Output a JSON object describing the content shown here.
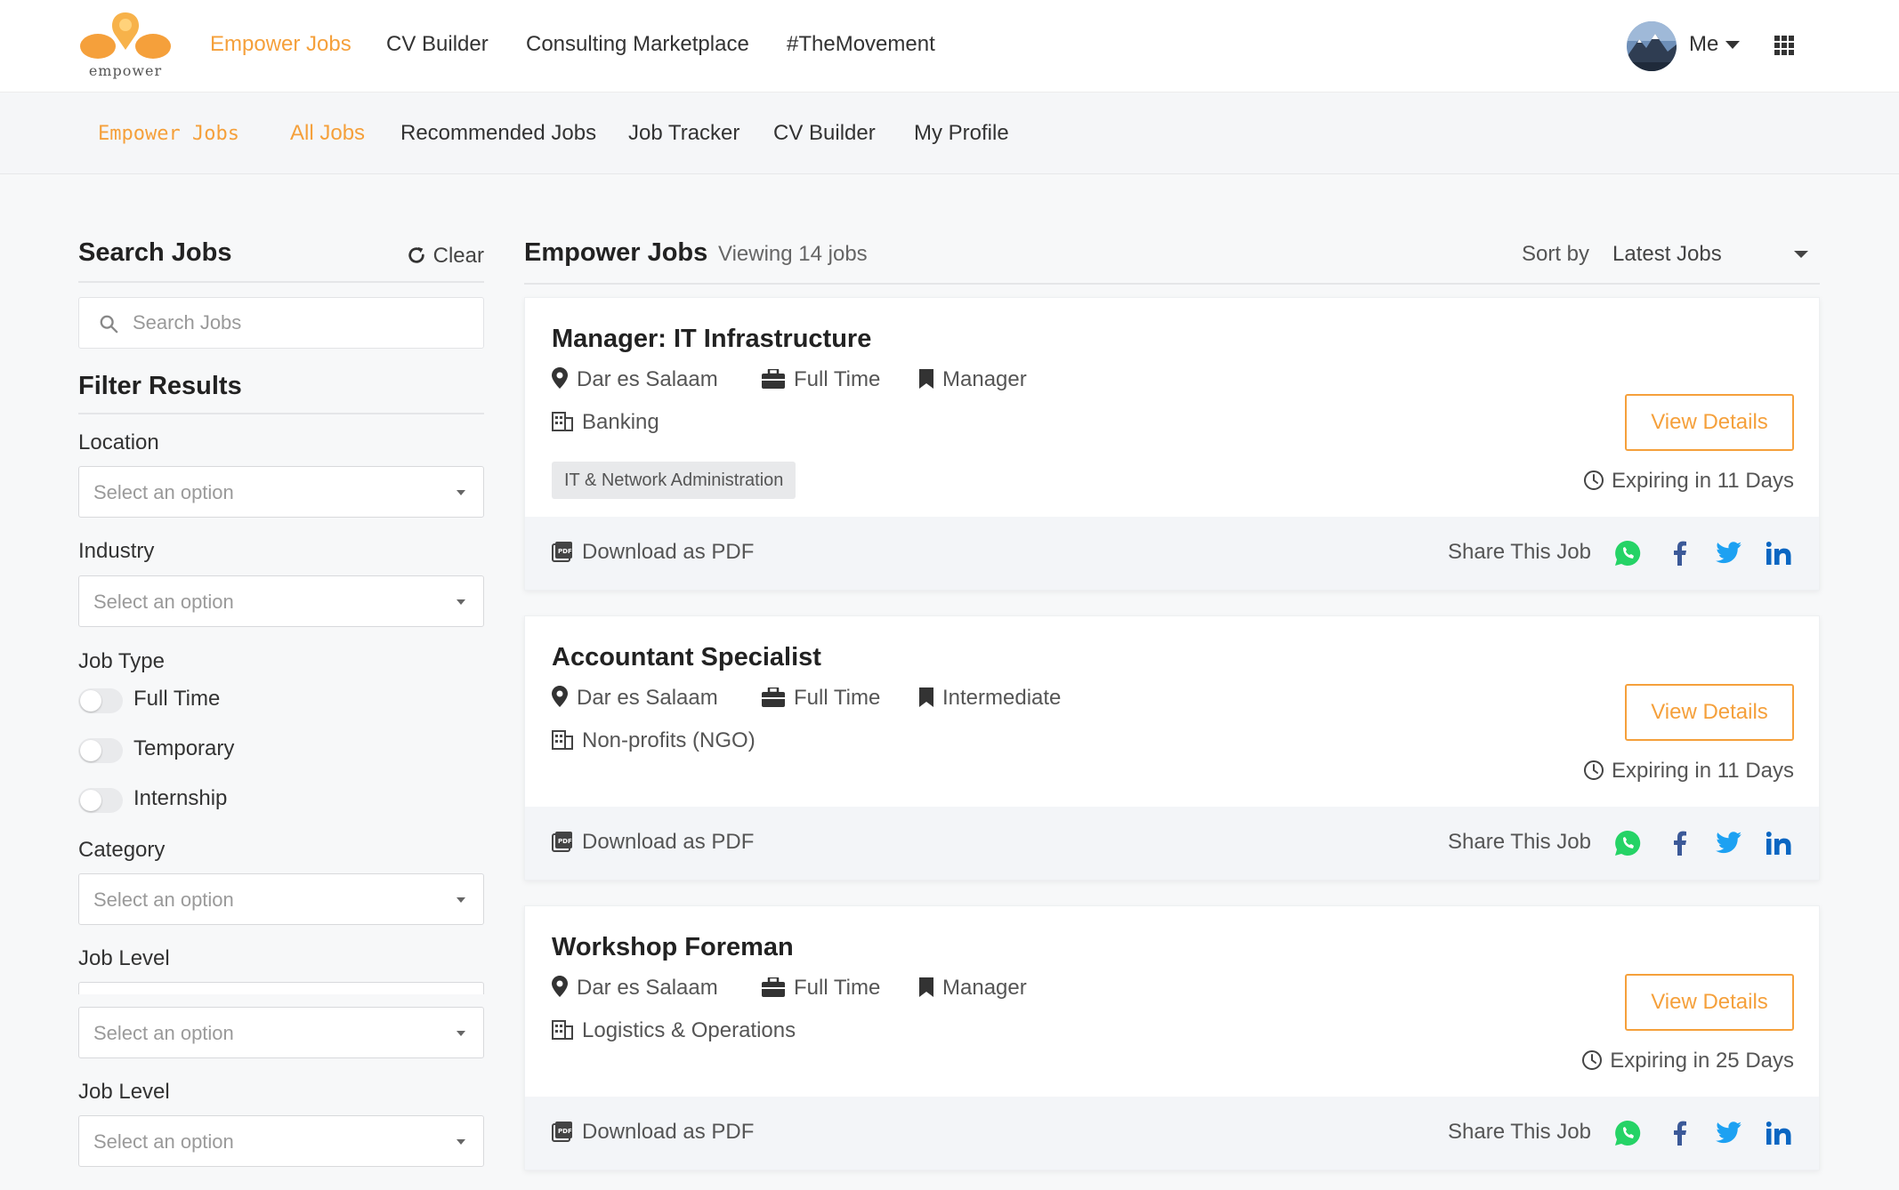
{
  "brand": {
    "logo_text": "empower",
    "colors": {
      "accent": "#f5a03b",
      "whatsapp": "#25d366",
      "facebook": "#3b5998",
      "twitter": "#1da1f2",
      "linkedin": "#0a66c2"
    }
  },
  "topnav": {
    "links": [
      "Empower Jobs",
      "CV Builder",
      "Consulting Marketplace",
      "#TheMovement"
    ],
    "active_index": 0,
    "me_label": "Me",
    "icons": [
      "avatar",
      "caret-down-icon",
      "apps-grid-icon"
    ]
  },
  "subnav": {
    "brand": "Empower Jobs",
    "links": [
      "All Jobs",
      "Recommended Jobs",
      "Job Tracker",
      "CV Builder",
      "My Profile"
    ],
    "active_index": 0
  },
  "sidebar": {
    "title": "Search Jobs",
    "clear_label": "Clear",
    "search_placeholder": "Search Jobs",
    "filter_title": "Filter Results",
    "location": {
      "label": "Location",
      "placeholder": "Select an option"
    },
    "industry": {
      "label": "Industry",
      "placeholder": "Select an option"
    },
    "job_type": {
      "label": "Job Type",
      "options": [
        {
          "label": "Full Time",
          "on": false
        },
        {
          "label": "Temporary",
          "on": false
        },
        {
          "label": "Internship",
          "on": false
        }
      ]
    },
    "category": {
      "label": "Category",
      "placeholder": "Select an option"
    },
    "job_level_1": {
      "label": "Job Level",
      "placeholder": "Select an option"
    },
    "job_level_2": {
      "label": "Job Level",
      "placeholder": "Select an option"
    }
  },
  "main": {
    "title": "Empower Jobs",
    "count_text": "Viewing 14 jobs",
    "sort_label": "Sort by",
    "sort_value": "Latest Jobs",
    "view_details_label": "View Details",
    "download_label": "Download as PDF",
    "share_label": "Share This Job",
    "jobs": [
      {
        "title": "Manager: IT Infrastructure",
        "location": "Dar es Salaam",
        "type": "Full Time",
        "level": "Manager",
        "industry": "Banking",
        "tag": "IT & Network Administration",
        "expiry": "Expiring in 11 Days"
      },
      {
        "title": "Accountant Specialist",
        "location": "Dar es Salaam",
        "type": "Full Time",
        "level": "Intermediate",
        "industry": "Non-profits (NGO)",
        "expiry": "Expiring in 11 Days"
      },
      {
        "title": "Workshop Foreman",
        "location": "Dar es Salaam",
        "type": "Full Time",
        "level": "Manager",
        "industry": "Logistics & Operations",
        "expiry": "Expiring in 25 Days"
      }
    ]
  }
}
